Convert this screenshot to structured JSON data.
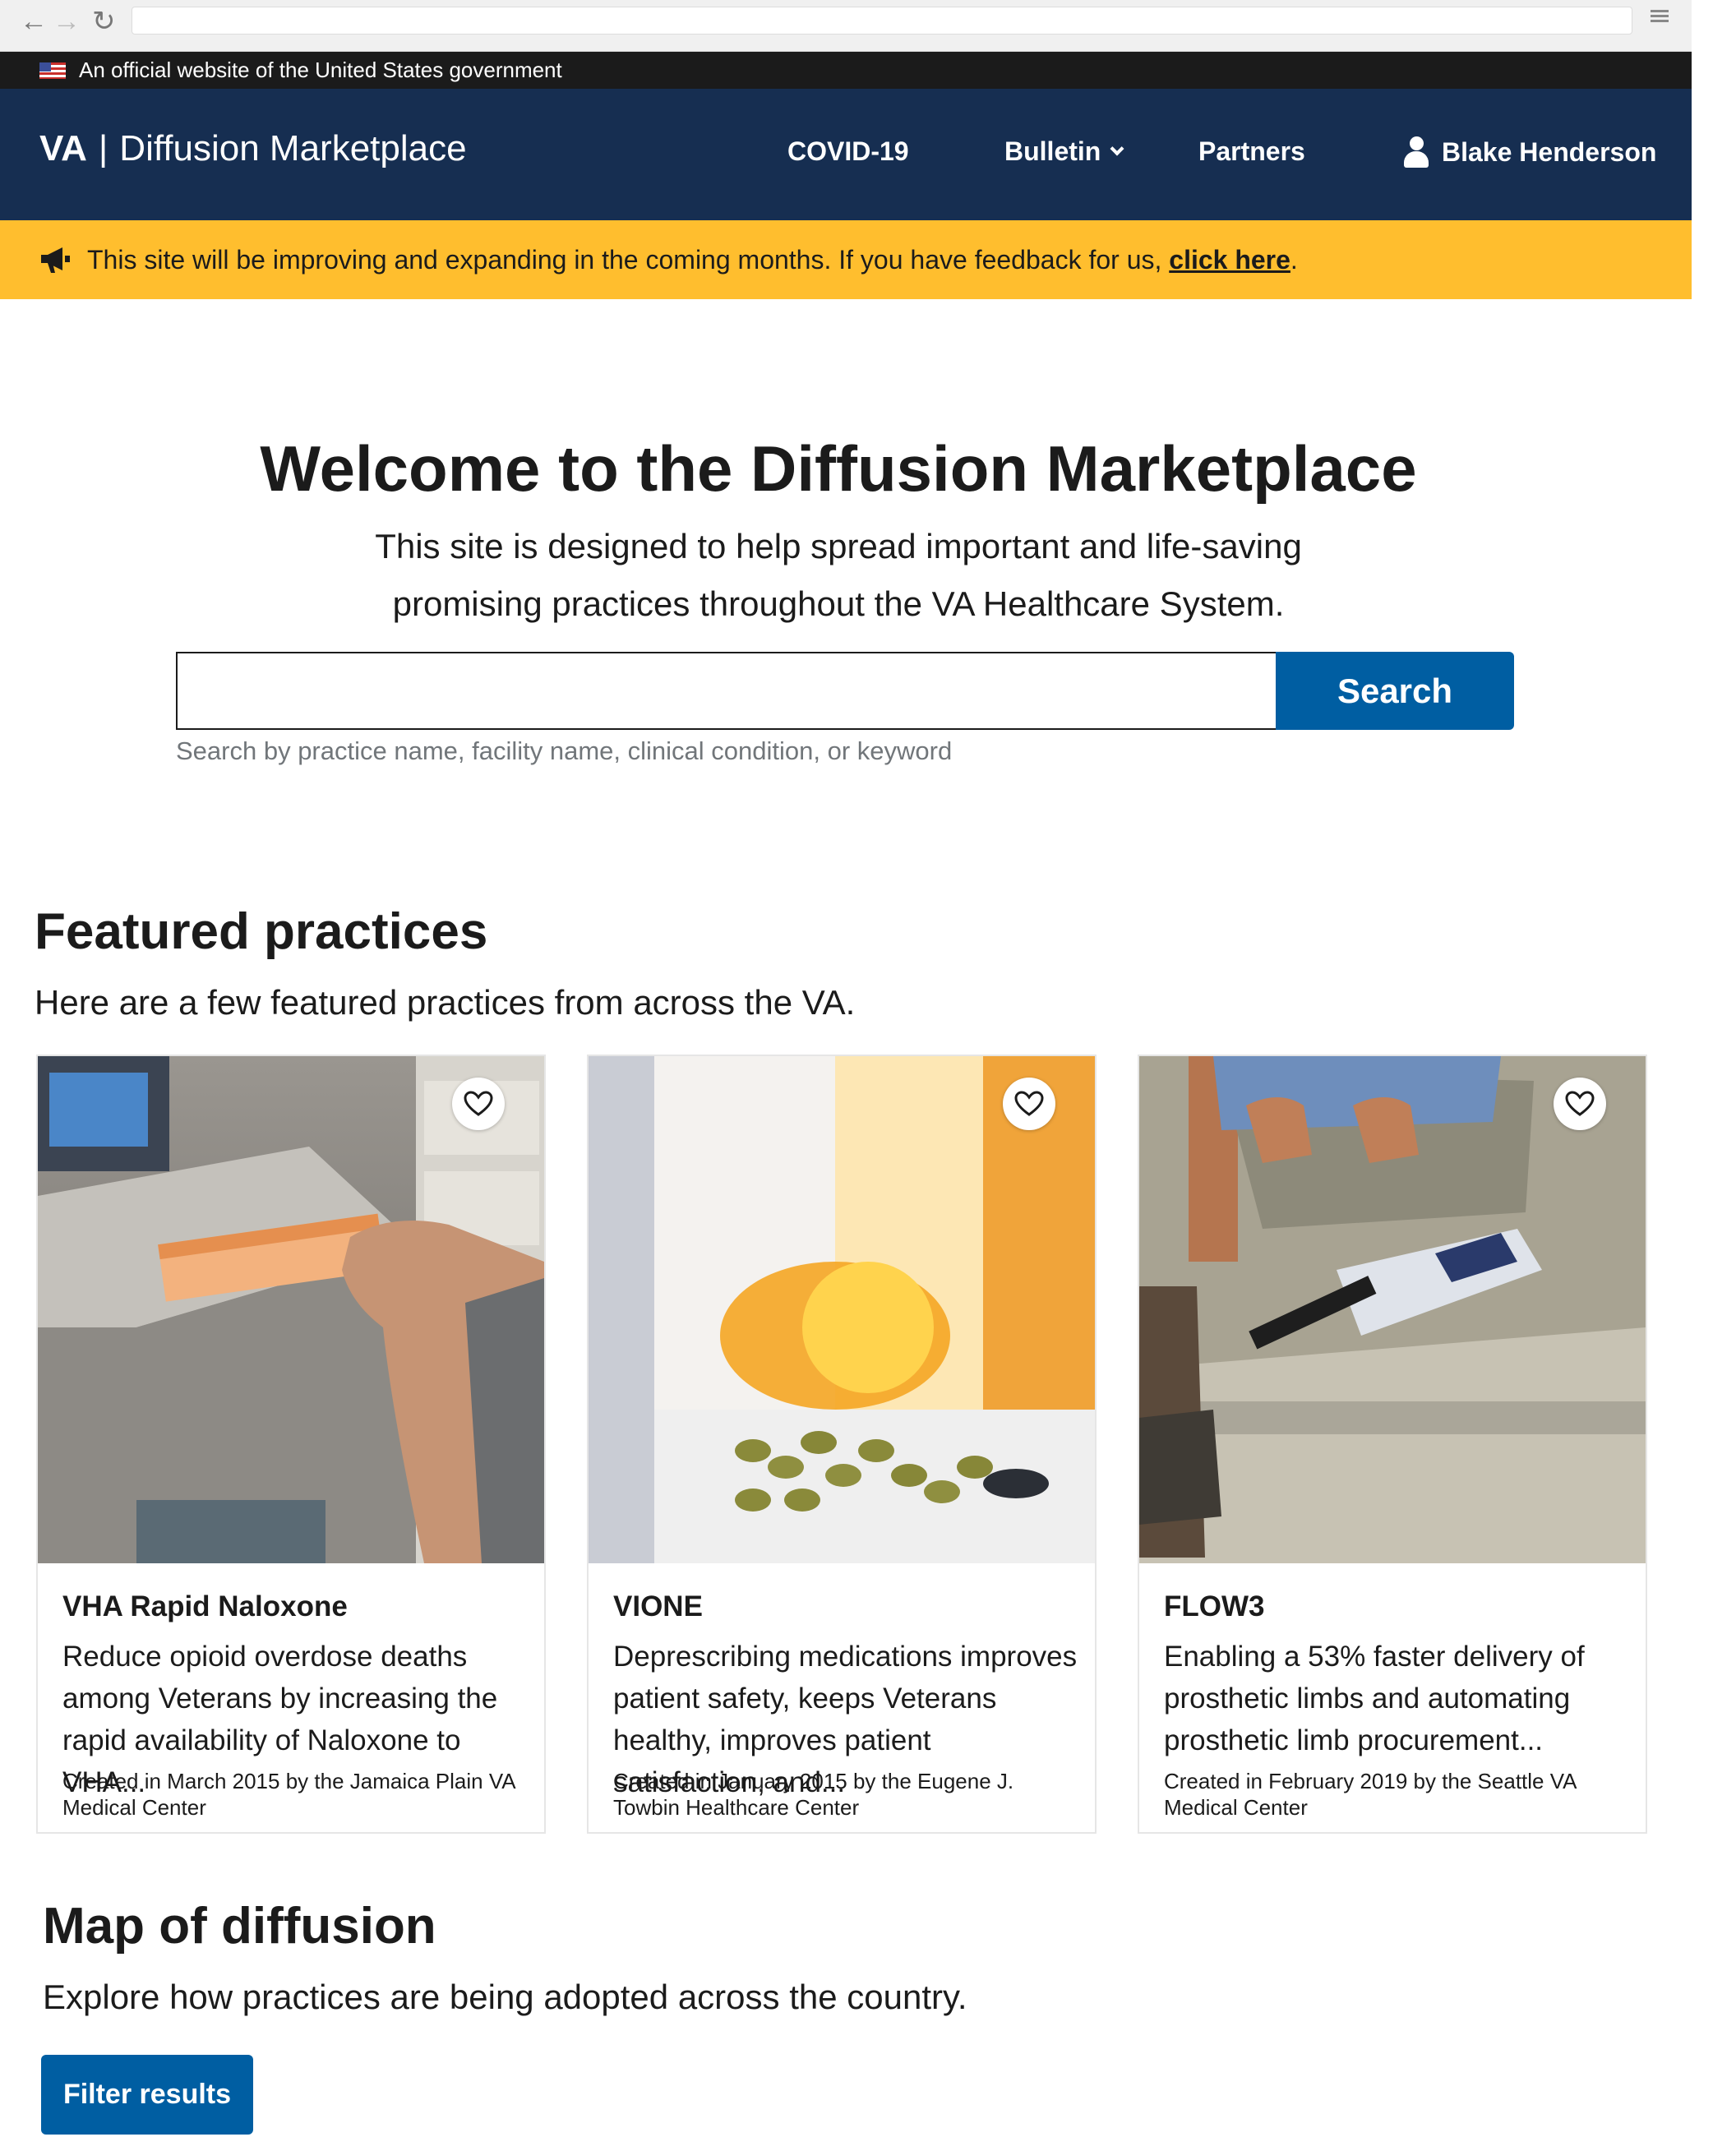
{
  "browser": {
    "back_icon": "arrow-left-icon",
    "forward_icon": "arrow-right-icon",
    "reload_icon": "reload-icon",
    "menu_icon": "hamburger-icon"
  },
  "gov_banner": {
    "text": "An official website of the United States government",
    "flag_icon": "us-flag-icon"
  },
  "header": {
    "logo_va": "VA",
    "logo_separator": "|",
    "logo_name": "Diffusion Marketplace",
    "nav": [
      {
        "label": "COVID-19"
      },
      {
        "label": "Bulletin"
      },
      {
        "label": "Partners"
      }
    ],
    "user_name": "Blake Henderson",
    "bg_color": "#162e51"
  },
  "alert": {
    "text": "This site will be improving and expanding in the coming months. If you have feedback for us,",
    "link_text": "click here",
    "suffix": ".",
    "icon": "megaphone-icon",
    "bg_color": "#ffbe2e"
  },
  "hero": {
    "title": "Welcome to the Diffusion Marketplace",
    "subtitle": "This site is designed to help spread important and life-saving promising practices throughout the VA Healthcare System."
  },
  "search": {
    "value": "",
    "button_label": "Search",
    "hint": "Search by practice name, facility name, clinical condition, or keyword",
    "button_color": "#005ea2"
  },
  "featured": {
    "title": "Featured practices",
    "subtitle": "Here are a few featured practices from across the VA.",
    "cards": [
      {
        "title": "VHA Rapid Naloxone",
        "description": "Reduce opioid overdose deaths among Veterans by increasing the rapid availability of Naloxone to VHA...",
        "meta": "Created in March 2015 by the Jamaica Plain VA Medical Center"
      },
      {
        "title": "VIONE",
        "description": "Deprescribing medications improves patient safety, keeps Veterans healthy, improves patient satisfaction, and...",
        "meta": "Created in January 2015 by the Eugene J. Towbin Healthcare Center"
      },
      {
        "title": "FLOW3",
        "description": "Enabling a 53% faster delivery of prosthetic limbs and automating prosthetic limb procurement...",
        "meta": "Created in February 2019 by the Seattle VA Medical Center"
      }
    ]
  },
  "map": {
    "title": "Map of diffusion",
    "subtitle": "Explore how practices are being adopted across the country.",
    "filter_button": "Filter results"
  }
}
